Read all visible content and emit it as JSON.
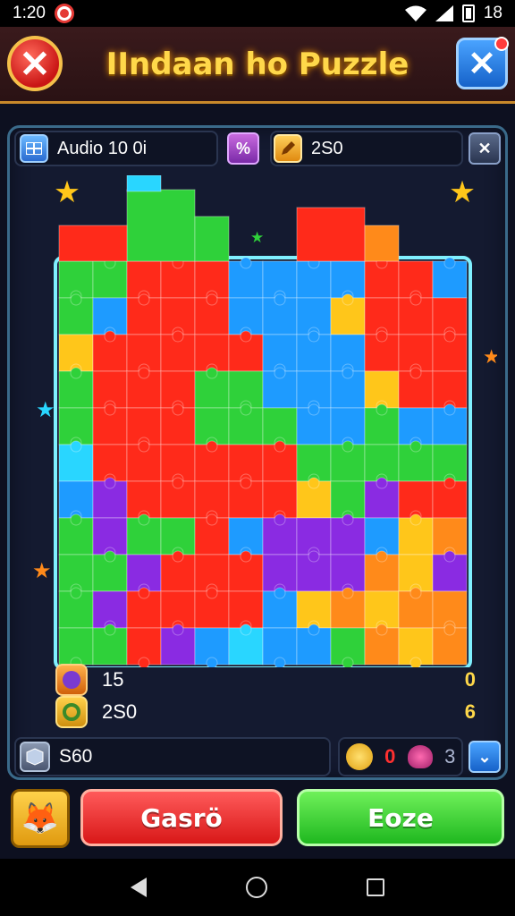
{
  "status": {
    "time": "1:20",
    "battery_text": "18"
  },
  "header": {
    "title": "IIndaan ho Puzzle",
    "close_left_icon": "close-icon",
    "close_right_icon": "close-icon"
  },
  "topbar": {
    "label": "Audio 10 0i",
    "percent_icon": "%",
    "score": "2S0"
  },
  "stats": [
    {
      "icon": "o",
      "value": "15",
      "right": "0"
    },
    {
      "icon": "@",
      "value": "2S0",
      "right": "6"
    }
  ],
  "bottombar": {
    "text": "S60",
    "count_red": "0",
    "count_right": "3"
  },
  "actions": {
    "red_label": "Gasrö",
    "green_label": "Eoze"
  },
  "colors": {
    "red": "#ff2a1a",
    "green": "#2fd13a",
    "blue": "#1e9bff",
    "yellow": "#ffc61a",
    "purple": "#8a2be2",
    "orange": "#ff8a1a",
    "cyan": "#29d6ff"
  },
  "board_grid": [
    "GGRRRBBBBRRB",
    "GBRRRBBBYRRR",
    "YRRRRRBBBRRR",
    "GRRRGGBBBYRR",
    "GRRRGGGBBGBB",
    "CRRRRRRGGGGG",
    "BPRRRRRYGPRR",
    "GPGGRBPPPBYO",
    "GGPRRRPPPOYP",
    "GPRRRRBYOYOO",
    "GGRPBCBBGOYO"
  ]
}
